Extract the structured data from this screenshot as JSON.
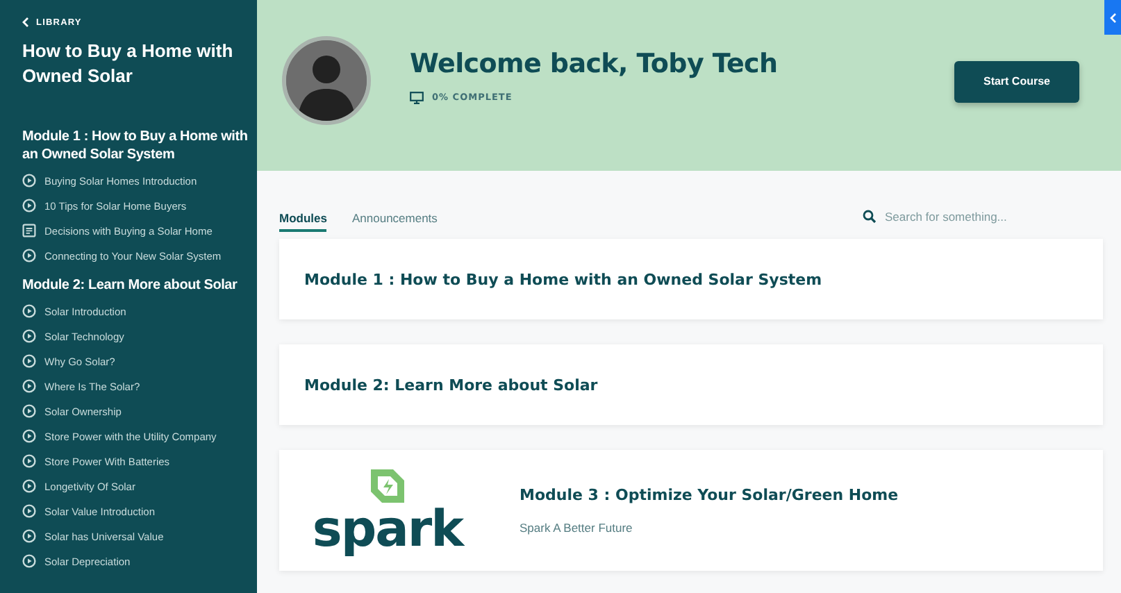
{
  "sidebar": {
    "back_link": "LIBRARY",
    "course_title": "How to Buy a Home with Owned Solar",
    "modules": [
      {
        "title": "Module 1 : How to Buy a Home with an Owned Solar System",
        "lessons": [
          {
            "title": "Buying Solar Homes Introduction",
            "kind": "video"
          },
          {
            "title": "10 Tips for Solar Home Buyers",
            "kind": "video"
          },
          {
            "title": "Decisions with Buying a Solar Home",
            "kind": "text"
          },
          {
            "title": "Connecting to Your New Solar System",
            "kind": "video"
          }
        ]
      },
      {
        "title": "Module 2: Learn More about Solar",
        "lessons": [
          {
            "title": "Solar Introduction",
            "kind": "video"
          },
          {
            "title": "Solar Technology",
            "kind": "video"
          },
          {
            "title": "Why Go Solar?",
            "kind": "video"
          },
          {
            "title": "Where Is The Solar?",
            "kind": "video"
          },
          {
            "title": "Solar Ownership",
            "kind": "video"
          },
          {
            "title": "Store Power with the Utility Company",
            "kind": "video"
          },
          {
            "title": "Store Power With Batteries",
            "kind": "video"
          },
          {
            "title": "Longetivity Of Solar",
            "kind": "video"
          },
          {
            "title": "Solar Value Introduction",
            "kind": "video"
          },
          {
            "title": "Solar has Universal Value",
            "kind": "video"
          },
          {
            "title": "Solar Depreciation",
            "kind": "video"
          }
        ]
      }
    ]
  },
  "header": {
    "welcome": "Welcome back, Toby Tech",
    "progress": "0% COMPLETE",
    "button": "Start Course"
  },
  "tabs": [
    {
      "label": "Modules",
      "selected": true
    },
    {
      "label": "Announcements",
      "selected": false
    }
  ],
  "search": {
    "placeholder": "Search for something..."
  },
  "modules": [
    {
      "title": "Module 1 : How to Buy a Home with an Owned Solar System"
    },
    {
      "title": "Module 2: Learn More about Solar"
    },
    {
      "title": "Module 3 : Optimize Your Solar/Green Home",
      "subtitle": "Spark A Better Future",
      "logo_text": "spark"
    }
  ]
}
